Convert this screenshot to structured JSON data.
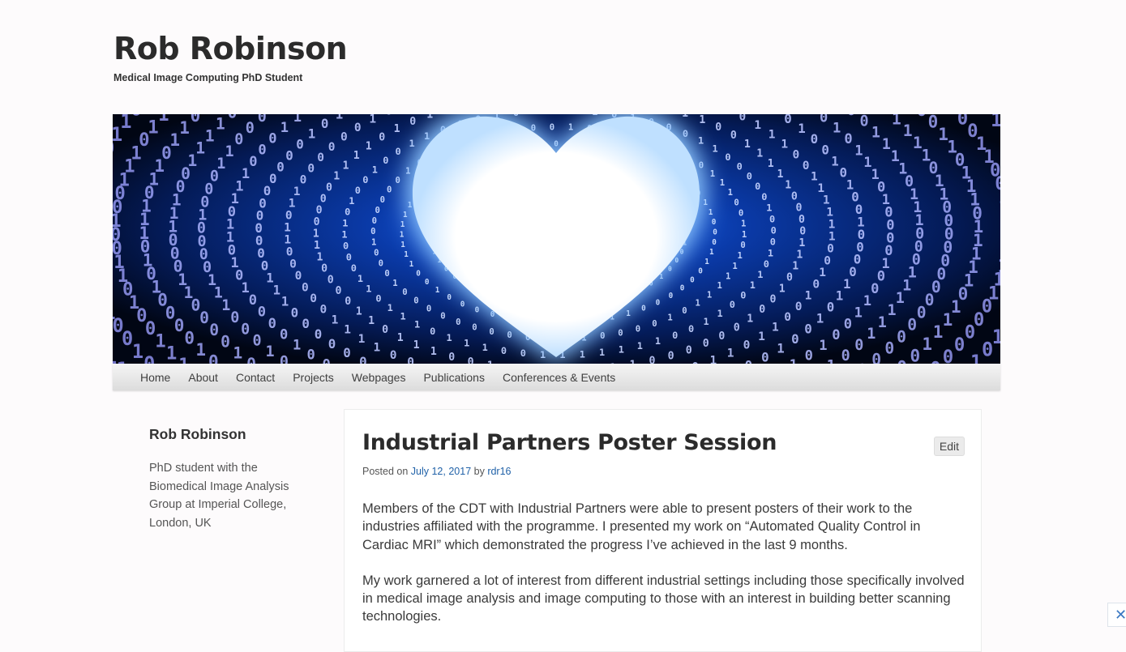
{
  "site": {
    "title": "Rob Robinson",
    "description": "Medical Image Computing PhD Student"
  },
  "banner": {
    "image": "binary-code-heart-tunnel",
    "colors": {
      "background": "#02071a",
      "digits": "#5aa2ff",
      "glow": "#ffffff"
    }
  },
  "nav": {
    "items": [
      {
        "label": "Home"
      },
      {
        "label": "About"
      },
      {
        "label": "Contact"
      },
      {
        "label": "Projects"
      },
      {
        "label": "Webpages"
      },
      {
        "label": "Publications"
      },
      {
        "label": "Conferences & Events"
      }
    ]
  },
  "sidebar": {
    "heading": "Rob Robinson",
    "bio": "PhD student with the Biomedical Image Analysis Group at Imperial College, London, UK"
  },
  "post": {
    "title": "Industrial Partners Poster Session",
    "edit_label": "Edit",
    "meta": {
      "posted_on": "Posted on",
      "date": "July 12, 2017",
      "by": "by",
      "author": "rdr16"
    },
    "paragraphs": [
      "Members of the CDT with Industrial Partners were able to present posters of their work to the industries affiliated with the programme. I presented my work on “Automated Quality Control in Cardiac MRI” which demonstrated the progress I’ve achieved in the last 9 months.",
      "My work garnered a lot of interest from different industrial settings including those specifically involved in medical image analysis and image computing to those with an interest in building better scanning technologies."
    ]
  },
  "corner_button": {
    "icon": "close-icon",
    "glyph": "✕"
  }
}
